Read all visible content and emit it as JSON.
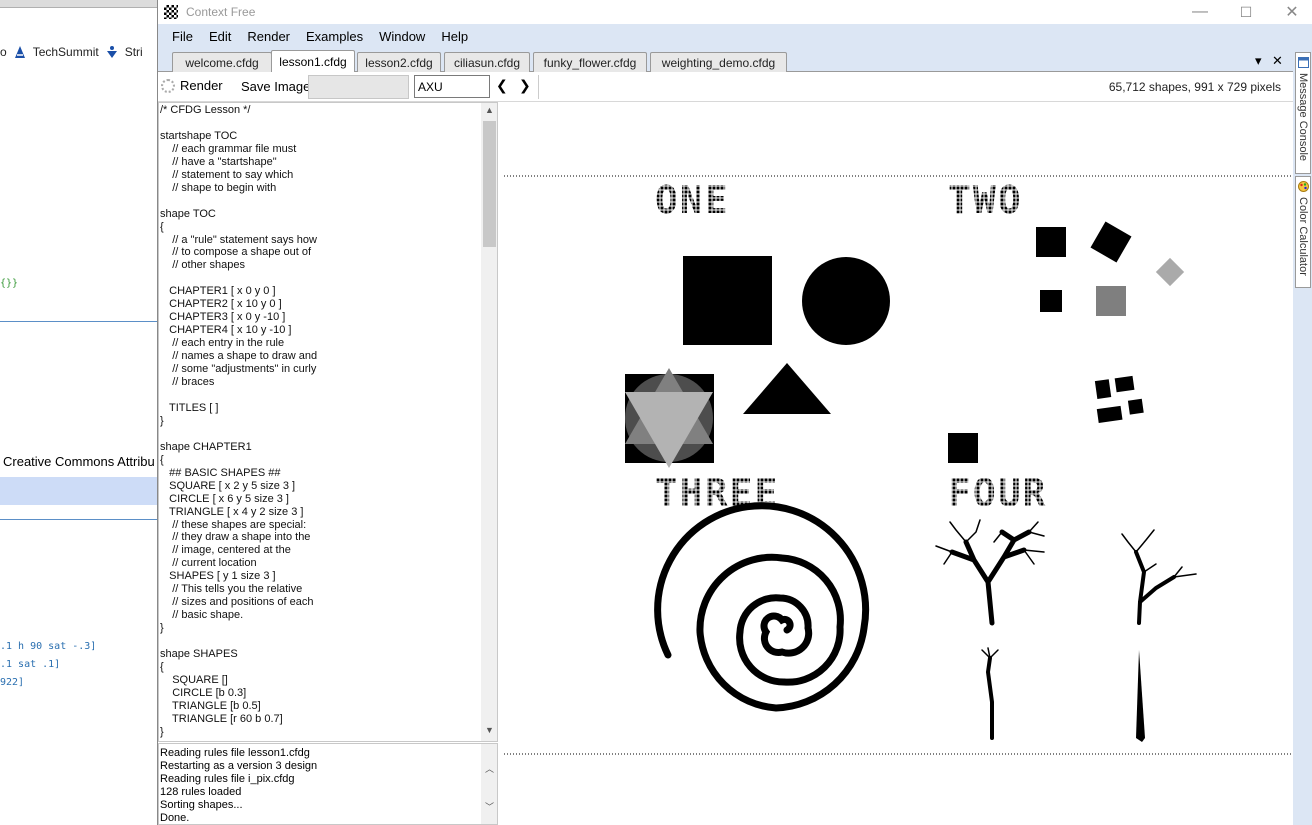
{
  "background_window": {
    "bookmarks": [
      "o",
      "TechSummit",
      "Stri"
    ],
    "code_braces": "{}}",
    "creative_commons_text": "Creative Commons Attribu",
    "code_lines": [
      ".1 h 90 sat -.3]",
      ".1 sat .1]",
      "922]"
    ]
  },
  "window": {
    "title": "Context Free",
    "minimize": "—",
    "maximize": "☐",
    "close": "✕"
  },
  "menu": [
    "File",
    "Edit",
    "Render",
    "Examples",
    "Window",
    "Help"
  ],
  "tabs": [
    {
      "label": "welcome.cfdg",
      "active": false
    },
    {
      "label": "lesson1.cfdg",
      "active": true
    },
    {
      "label": "lesson2.cfdg",
      "active": false
    },
    {
      "label": "ciliasun.cfdg",
      "active": false
    },
    {
      "label": "funky_flower.cfdg",
      "active": false
    },
    {
      "label": "weighting_demo.cfdg",
      "active": false
    }
  ],
  "tab_controls": {
    "dropdown": "▾",
    "close": "✕"
  },
  "toolbar": {
    "render_label": "Render",
    "save_label": "Save Image",
    "variation_value": "AXU",
    "prev": "❮",
    "next": "❯",
    "status": "65,712 shapes, 991 x 729 pixels"
  },
  "editor": {
    "code": "/* CFDG Lesson */\n\nstartshape TOC\n    // each grammar file must\n    // have a \"startshape\"\n    // statement to say which\n    // shape to begin with\n\nshape TOC\n{\n    // a \"rule\" statement says how\n    // to compose a shape out of\n    // other shapes\n\n   CHAPTER1 [ x 0 y 0 ]\n   CHAPTER2 [ x 10 y 0 ]\n   CHAPTER3 [ x 0 y -10 ]\n   CHAPTER4 [ x 10 y -10 ]\n    // each entry in the rule\n    // names a shape to draw and\n    // some \"adjustments\" in curly\n    // braces\n\n   TITLES [ ]\n}\n\nshape CHAPTER1\n{\n   ## BASIC SHAPES ##\n   SQUARE [ x 2 y 5 size 3 ]\n   CIRCLE [ x 6 y 5 size 3 ]\n   TRIANGLE [ x 4 y 2 size 3 ]\n    // these shapes are special:\n    // they draw a shape into the\n    // image, centered at the\n    // current location\n   SHAPES [ y 1 size 3 ]\n    // This tells you the relative\n    // sizes and positions of each\n    // basic shape.\n}\n\nshape SHAPES\n{\n    SQUARE []\n    CIRCLE [b 0.3]\n    TRIANGLE [b 0.5]\n    TRIANGLE [r 60 b 0.7]\n}"
  },
  "console": {
    "lines": [
      "Reading rules file lesson1.cfdg",
      "Restarting as a version 3 design",
      "Reading rules file i_pix.cfdg",
      "128 rules loaded",
      "Sorting shapes...",
      "Done."
    ]
  },
  "canvas": {
    "titles": [
      "ONE",
      "TWO",
      "THREE",
      "FOUR"
    ]
  },
  "side_tabs": [
    "Message Console",
    "Color Calculator"
  ]
}
